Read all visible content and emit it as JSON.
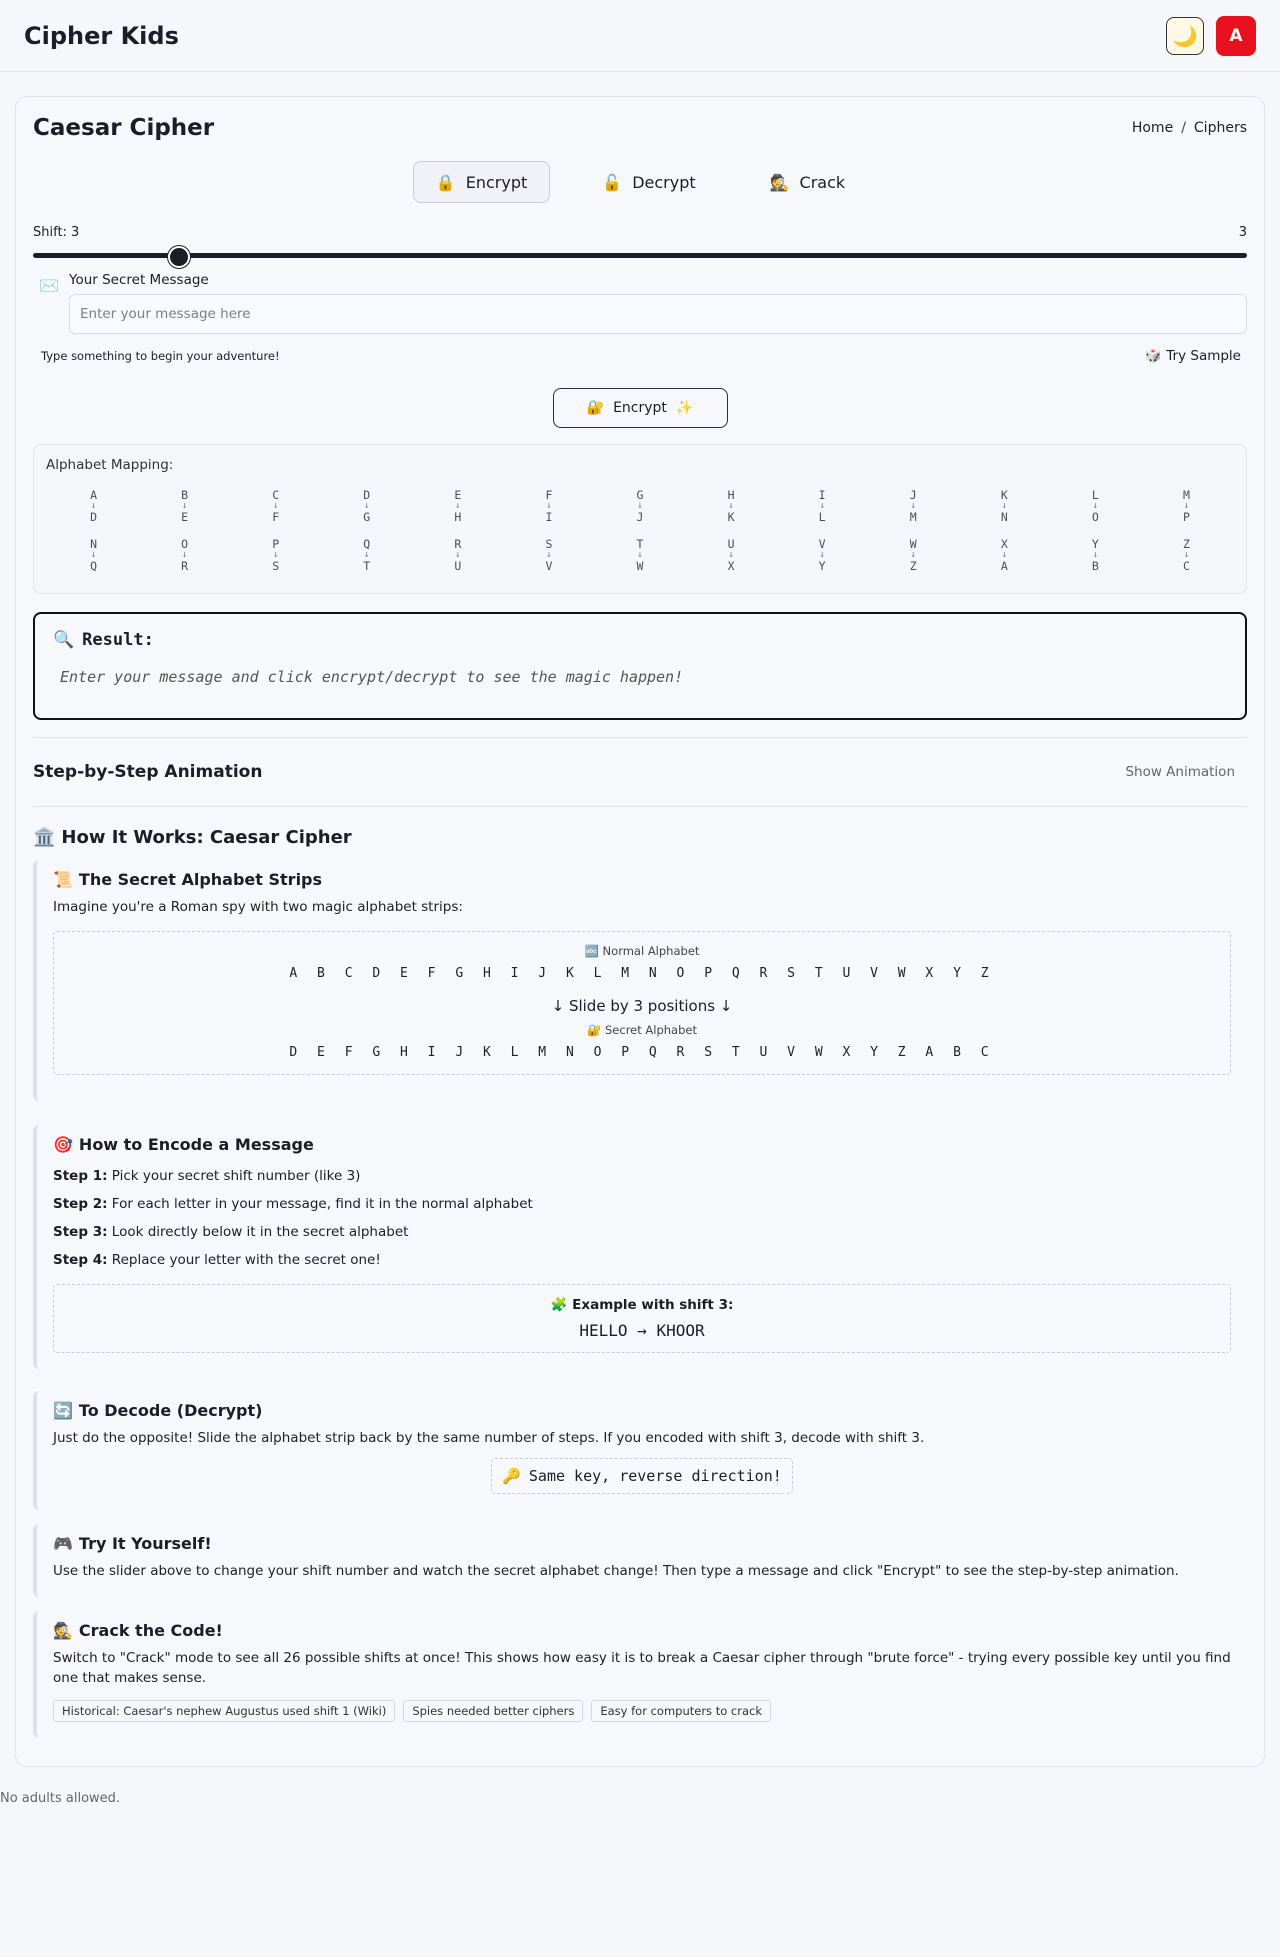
{
  "app": {
    "title": "Cipher Kids",
    "theme_icon": "moon-icon",
    "avatar_letter": "A"
  },
  "page": {
    "title": "Caesar Cipher",
    "breadcrumb": [
      "Home",
      "/",
      "Ciphers"
    ]
  },
  "tabs": [
    {
      "icon": "🔒",
      "label": "Encrypt"
    },
    {
      "icon": "🔓",
      "label": "Decrypt"
    },
    {
      "icon": "🕵️",
      "label": "Crack"
    }
  ],
  "shift": {
    "label": "Shift: 3",
    "value": 3,
    "value_text": "3",
    "min": 0,
    "max": 25
  },
  "message": {
    "label": "Your Secret Message",
    "placeholder": "Enter your message here",
    "hint": "Type something to begin your adventure!",
    "sample_icon": "🎲",
    "sample_label": "Try Sample"
  },
  "encrypt_button": {
    "icon": "🔐",
    "label": "Encrypt",
    "sparkle": "✨"
  },
  "mapping": {
    "title": "Alphabet Mapping:",
    "arrow": "↓",
    "pairs": [
      [
        "A",
        "D"
      ],
      [
        "B",
        "E"
      ],
      [
        "C",
        "F"
      ],
      [
        "D",
        "G"
      ],
      [
        "E",
        "H"
      ],
      [
        "F",
        "I"
      ],
      [
        "G",
        "J"
      ],
      [
        "H",
        "K"
      ],
      [
        "I",
        "L"
      ],
      [
        "J",
        "M"
      ],
      [
        "K",
        "N"
      ],
      [
        "L",
        "O"
      ],
      [
        "M",
        "P"
      ],
      [
        "N",
        "Q"
      ],
      [
        "O",
        "R"
      ],
      [
        "P",
        "S"
      ],
      [
        "Q",
        "T"
      ],
      [
        "R",
        "U"
      ],
      [
        "S",
        "V"
      ],
      [
        "T",
        "W"
      ],
      [
        "U",
        "X"
      ],
      [
        "V",
        "Y"
      ],
      [
        "W",
        "Z"
      ],
      [
        "X",
        "A"
      ],
      [
        "Y",
        "B"
      ],
      [
        "Z",
        "C"
      ]
    ]
  },
  "result": {
    "icon": "🔍",
    "title": "Result:",
    "text": "Enter your message and click encrypt/decrypt to see the magic happen!"
  },
  "animation": {
    "title": "Step-by-Step Animation",
    "button": "Show Animation"
  },
  "how": {
    "icon": "🏛️",
    "title": "How It Works: Caesar Cipher",
    "strips": {
      "icon": "📜",
      "title": "The Secret Alphabet Strips",
      "intro": "Imagine you're a Roman spy with two magic alphabet strips:",
      "normal_label": "🔤 Normal Alphabet",
      "normal": "ABCDEFGHIJKLMNOPQRSTUVWXYZ",
      "slide": "↓ Slide by 3 positions ↓",
      "secret_label": "🔐 Secret Alphabet",
      "secret": "DEFGHIJKLMNOPQRSTUVWXYZABC"
    },
    "encode": {
      "icon": "🎯",
      "title": "How to Encode a Message",
      "steps": [
        {
          "label": "Step 1:",
          "text": " Pick your secret shift number (like 3)"
        },
        {
          "label": "Step 2:",
          "text": " For each letter in your message, find it in the normal alphabet"
        },
        {
          "label": "Step 3:",
          "text": " Look directly below it in the secret alphabet"
        },
        {
          "label": "Step 4:",
          "text": " Replace your letter with the secret one!"
        }
      ],
      "example_title": "🧩 Example with shift 3:",
      "example": "HELLO → KHOOR"
    },
    "decode": {
      "icon": "🔄",
      "title": "To Decode (Decrypt)",
      "text": "Just do the opposite! Slide the alphabet strip back by the same number of steps. If you encoded with shift 3, decode with shift 3.",
      "key_icon": "🔑",
      "key_text": "Same key, reverse direction!"
    },
    "try": {
      "icon": "🎮",
      "title": "Try It Yourself!",
      "text": "Use the slider above to change your shift number and watch the secret alphabet change! Then type a message and click \"Encrypt\" to see the step-by-step animation."
    },
    "crack": {
      "icon": "🕵️",
      "title": "Crack the Code!",
      "text": "Switch to \"Crack\" mode to see all 26 possible shifts at once! This shows how easy it is to break a Caesar cipher through \"brute force\" - trying every possible key until you find one that makes sense.",
      "tags": [
        "Historical: Caesar's nephew Augustus used shift 1 (Wiki)",
        "Spies needed better ciphers",
        "Easy for computers to crack"
      ]
    }
  },
  "footer": "No adults allowed."
}
